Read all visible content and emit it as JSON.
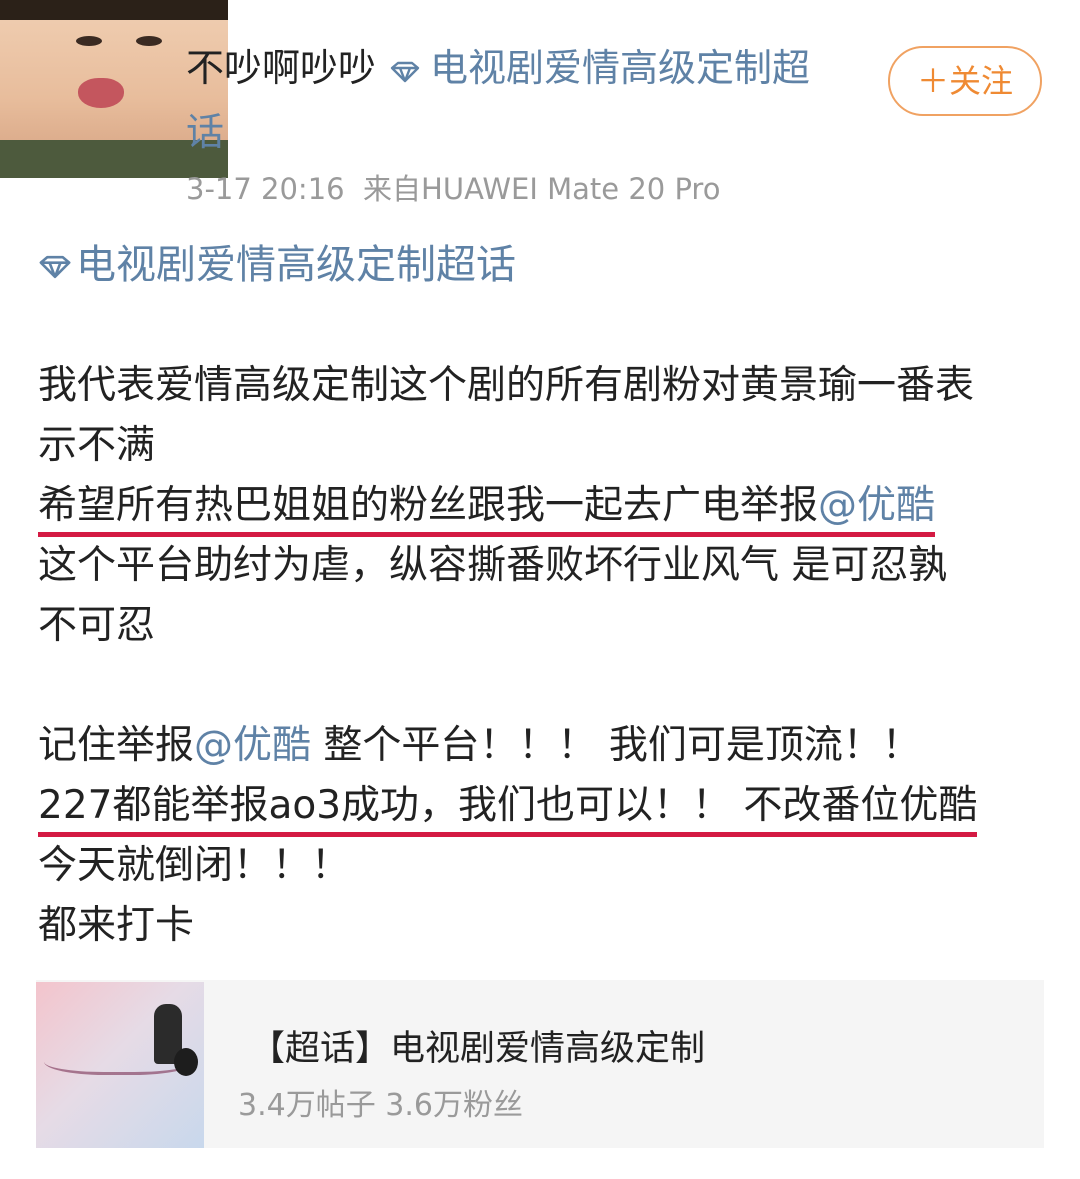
{
  "post": {
    "username": "不吵啊吵吵",
    "topic_tag": "电视剧爱情高级定制超话",
    "follow_label": "＋关注",
    "timestamp": "3-17 20:16",
    "source": "来自HUAWEI Mate 20 Pro",
    "topic_link": "电视剧爱情高级定制超话",
    "body": {
      "p1_l1": "我代表爱情高级定制这个剧的所有剧粉对黄景瑜一番表",
      "p1_l2": "示不满",
      "p1_l3_a": "希望所有热巴姐姐的粉丝跟我一起去广电举报",
      "p1_l3_mention": "@优酷",
      "p1_l4": "这个平台助纣为虐，纵容撕番败坏行业风气 是可忍孰",
      "p1_l5": "不可忍",
      "p2_l1_a": "记住举报",
      "p2_l1_mention": "@优酷",
      "p2_l1_b": " 整个平台！！！ 我们可是顶流！！",
      "p2_l2": "227都能举报ao3成功，我们也可以！！ 不改番位优酷",
      "p2_l3": "今天就倒闭！！！",
      "p2_l4": "都来打卡"
    }
  },
  "card": {
    "title": "【超话】电视剧爱情高级定制",
    "stats": "3.4万帖子 3.6万粉丝",
    "thumb_icon": "drama-poster-thumbnail"
  },
  "colors": {
    "link": "#5f82a6",
    "follow": "#ef8a33",
    "underline": "#d41a43",
    "meta": "#9a9a9a"
  }
}
